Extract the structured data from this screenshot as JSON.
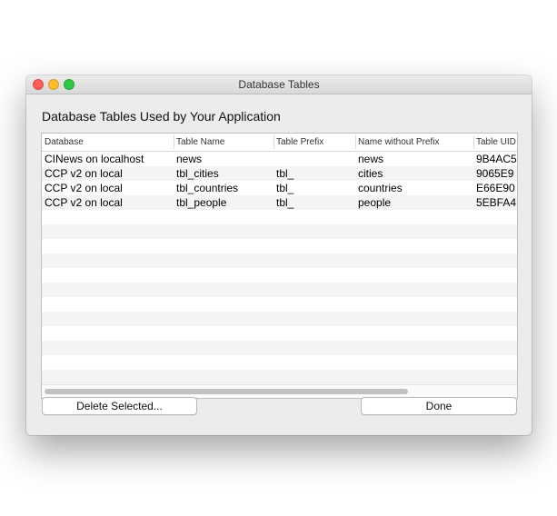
{
  "window": {
    "title": "Database Tables"
  },
  "heading": "Database Tables Used by Your Application",
  "table": {
    "columns": [
      "Database",
      "Table Name",
      "Table Prefix",
      "Name without Prefix",
      "Table UID"
    ],
    "rows": [
      [
        "CINews on localhost",
        "news",
        "",
        "news",
        "9B4AC5"
      ],
      [
        "CCP v2 on local",
        "tbl_cities",
        "tbl_",
        "cities",
        "9065E9"
      ],
      [
        "CCP v2 on local",
        "tbl_countries",
        "tbl_",
        "countries",
        "E66E90"
      ],
      [
        "CCP v2 on local",
        "tbl_people",
        "tbl_",
        "people",
        "5EBFA4"
      ]
    ]
  },
  "buttons": {
    "delete": "Delete Selected...",
    "done": "Done"
  },
  "colors": {
    "close": "#fc5f57",
    "minimize": "#fdbc2e",
    "maximize": "#33c748"
  }
}
